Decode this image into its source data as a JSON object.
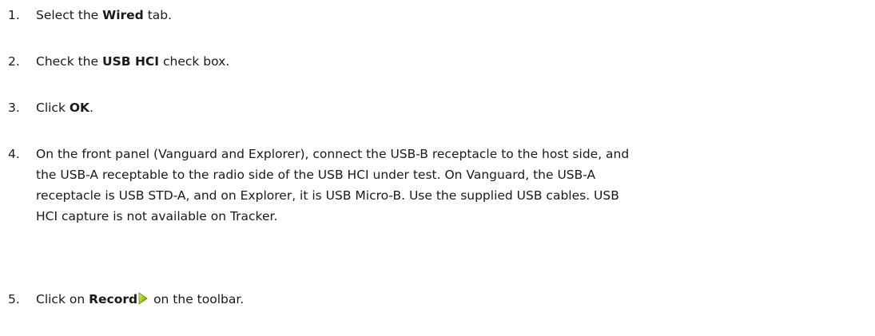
{
  "steps": [
    {
      "number": "1.",
      "pre": "Select the ",
      "bold": "Wired",
      "post": " tab."
    },
    {
      "number": "2.",
      "pre": "Check the ",
      "bold": "USB HCI",
      "post": " check box."
    },
    {
      "number": "3.",
      "pre": "Click ",
      "bold": "OK",
      "post": "."
    },
    {
      "number": "4.",
      "lines": [
        "On the front panel (Vanguard and Explorer), connect the USB-B receptacle to the host side, and",
        "the USB-A receptable to the radio side of the USB HCI under test.  On Vanguard, the USB-A",
        "receptacle is USB STD-A, and on Explorer, it is USB Micro-B.  Use the supplied USB cables.  USB",
        "HCI capture is not available on Tracker."
      ]
    },
    {
      "number": "5.",
      "pre": "Click on ",
      "bold": "Record",
      "icon": "record-play-icon",
      "post": " on the toolbar."
    }
  ]
}
